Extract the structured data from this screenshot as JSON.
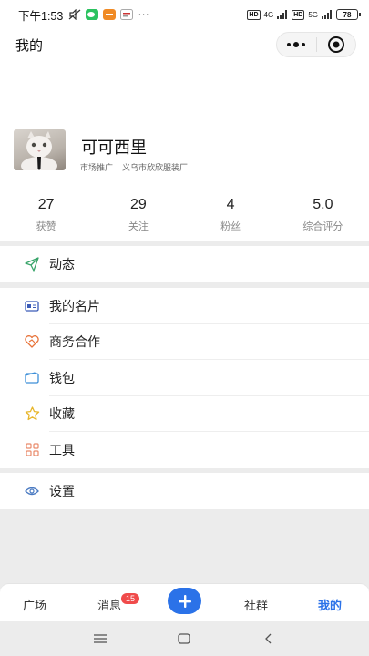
{
  "status_bar": {
    "time": "下午1:53",
    "battery": "78",
    "sig1": "4G",
    "sig2": "5G",
    "hd": "HD",
    "more": "···"
  },
  "header": {
    "title": "我的"
  },
  "profile": {
    "name": "可可西里",
    "role": "市场推广",
    "company": "义乌市欣欣服装厂"
  },
  "stats": [
    {
      "value": "27",
      "label": "获赞"
    },
    {
      "value": "29",
      "label": "关注"
    },
    {
      "value": "4",
      "label": "粉丝"
    },
    {
      "value": "5.0",
      "label": "综合评分"
    }
  ],
  "menu": {
    "dynamics": {
      "label": "动态",
      "icon": "paper-plane-icon"
    },
    "items": [
      {
        "label": "我的名片",
        "icon": "card-icon"
      },
      {
        "label": "商务合作",
        "icon": "handshake-icon"
      },
      {
        "label": "钱包",
        "icon": "wallet-icon"
      },
      {
        "label": "收藏",
        "icon": "star-icon"
      },
      {
        "label": "工具",
        "icon": "grid-icon"
      }
    ],
    "settings": {
      "label": "设置",
      "icon": "eye-settings-icon"
    }
  },
  "tabbar": {
    "tabs": [
      "广场",
      "消息",
      "社群",
      "我的"
    ],
    "message_badge": "15",
    "active": "我的"
  },
  "colors": {
    "accent": "#2b72e8",
    "badge": "#f04b4b"
  }
}
